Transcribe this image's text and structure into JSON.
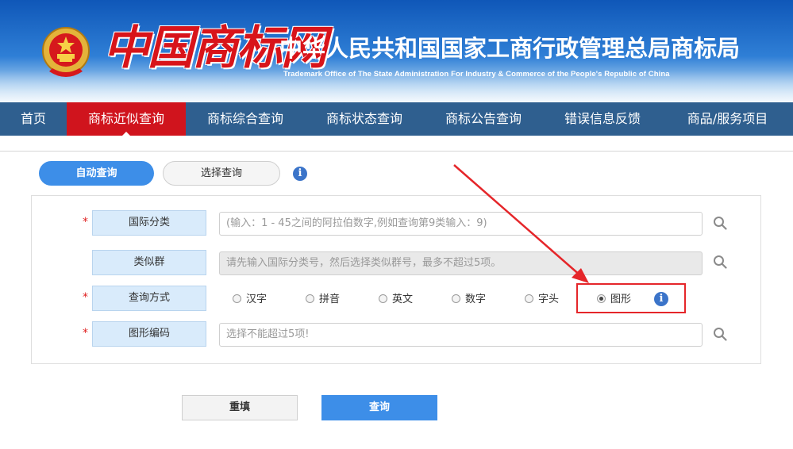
{
  "header": {
    "logo_text": "中国商标网",
    "org_cn": "中华人民共和国国家工商行政管理总局商标局",
    "org_en": "Trademark Office of The State Administration For Industry & Commerce of the People's Republic of China",
    "emblem_icon": "national-emblem-icon"
  },
  "nav": {
    "items": [
      {
        "label": "首页"
      },
      {
        "label": "商标近似查询",
        "active": true
      },
      {
        "label": "商标综合查询"
      },
      {
        "label": "商标状态查询"
      },
      {
        "label": "商标公告查询"
      },
      {
        "label": "错误信息反馈"
      },
      {
        "label": "商品/服务项目"
      }
    ]
  },
  "tabs": {
    "auto": "自动查询",
    "select": "选择查询",
    "info_icon": "info-icon"
  },
  "form": {
    "required_mark": "*",
    "intl_class": {
      "label": "国际分类",
      "placeholder": "(输入：1 - 45之间的阿拉伯数字,例如查询第9类输入：9)"
    },
    "similar_group": {
      "label": "类似群",
      "placeholder": "请先输入国际分类号，然后选择类似群号，最多不超过5项。"
    },
    "query_method": {
      "label": "查询方式",
      "options": [
        "汉字",
        "拼音",
        "英文",
        "数字",
        "字头",
        "图形"
      ],
      "selected": "图形"
    },
    "figure_code": {
      "label": "图形编码",
      "placeholder": "选择不能超过5项!"
    }
  },
  "buttons": {
    "reset": "重填",
    "query": "查询"
  },
  "colors": {
    "nav_bg": "#2f5f8f",
    "nav_active": "#d0141d",
    "primary": "#3d8ee8",
    "highlight": "#e5262a"
  }
}
